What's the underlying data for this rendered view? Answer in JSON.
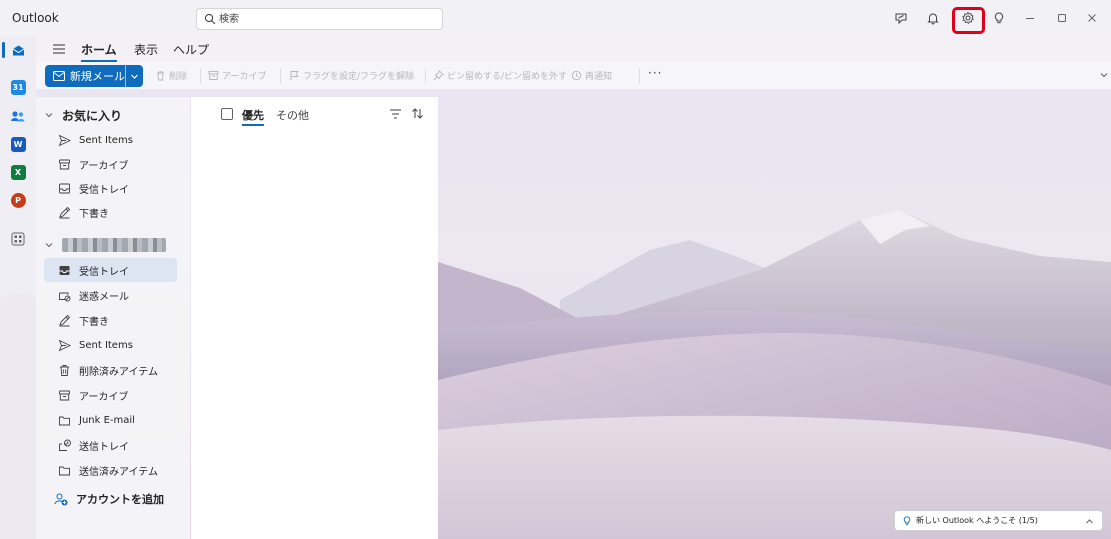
{
  "titlebar": {
    "app_name": "Outlook",
    "search_placeholder": "検索",
    "buttons": [
      "whatsnew-icon",
      "bell-icon",
      "gear-icon",
      "lightbulb-icon",
      "minimize-icon",
      "maximize-icon",
      "close-icon"
    ]
  },
  "rail": {
    "items": [
      "mail-icon",
      "calendar-icon",
      "people-icon",
      "word-icon",
      "excel-icon",
      "powerpoint-icon",
      "apps-icon"
    ],
    "app_letters": {
      "calendar": "31",
      "word": "W",
      "excel": "X",
      "powerpoint": "P"
    },
    "active": "mail-icon"
  },
  "menu": {
    "tabs": [
      {
        "label": "ホーム",
        "active": true
      },
      {
        "label": "表示",
        "active": false
      },
      {
        "label": "ヘルプ",
        "active": false
      }
    ]
  },
  "ribbon": {
    "new_mail": "新規メール",
    "delete": "削除",
    "archive": "アーカイブ",
    "flag": "フラグを設定/フラグを解除",
    "pin": "ピン留めする/ピン留めを外す",
    "snooze": "再通知",
    "more": "···"
  },
  "folders": {
    "favorites_title": "お気に入り",
    "favorites": [
      {
        "icon": "send-icon",
        "label": "Sent Items"
      },
      {
        "icon": "archive-icon",
        "label": "アーカイブ"
      },
      {
        "icon": "inbox-icon",
        "label": "受信トレイ"
      },
      {
        "icon": "draft-icon",
        "label": "下書き"
      }
    ],
    "account_items": [
      {
        "icon": "inbox-icon",
        "label": "受信トレイ",
        "selected": true
      },
      {
        "icon": "junk-icon",
        "label": "迷惑メール",
        "selected": false
      },
      {
        "icon": "draft-icon",
        "label": "下書き",
        "selected": false
      },
      {
        "icon": "send-icon",
        "label": "Sent Items",
        "selected": false
      },
      {
        "icon": "trash-icon",
        "label": "削除済みアイテム",
        "selected": false
      },
      {
        "icon": "archive-icon",
        "label": "アーカイブ",
        "selected": false
      },
      {
        "icon": "folder-icon",
        "label": "Junk E-mail",
        "selected": false
      },
      {
        "icon": "outbox-icon",
        "label": "送信トレイ",
        "selected": false
      },
      {
        "icon": "folder-icon",
        "label": "送信済みアイテム",
        "selected": false
      }
    ],
    "add_account": "アカウントを追加"
  },
  "message_list": {
    "tab_focused": "優先",
    "tab_other": "その他"
  },
  "toast": {
    "text": "新しい Outlook へようこそ (1/5)"
  },
  "colors": {
    "accent": "#0f6cbd",
    "highlight_box": "#e0001b",
    "selected_folder": "#dde4f2"
  }
}
